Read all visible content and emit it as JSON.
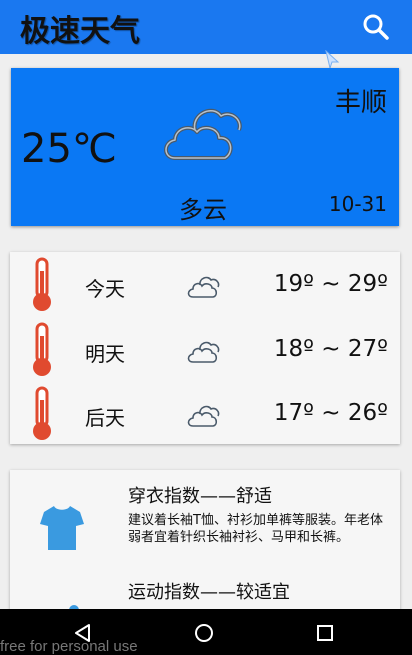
{
  "appbar": {
    "title": "极速天气",
    "search_icon": "search-icon"
  },
  "current": {
    "city": "丰顺",
    "temperature": "25℃",
    "condition": "多云",
    "date": "10-31",
    "icon": "cloud-icon"
  },
  "forecast": [
    {
      "day": "今天",
      "range": "19º ~ 29º",
      "icon": "cloud-icon"
    },
    {
      "day": "明天",
      "range": "18º ~ 27º",
      "icon": "cloud-icon"
    },
    {
      "day": "后天",
      "range": "17º ~ 26º",
      "icon": "cloud-icon"
    }
  ],
  "life": {
    "clothing_title": "穿衣指数——舒适",
    "clothing_text": "建议着长袖T恤、衬衫加单裤等服装。年老体弱者宜着针织长袖衬衫、马甲和长裤。",
    "sport_title": "运动指数——较适宜"
  },
  "navbar": {
    "back": "back-icon",
    "home": "home-icon",
    "recents": "recents-icon"
  },
  "watermark": "free for personal use",
  "colors": {
    "appbar": "#1a78f0",
    "hero": "#0a78f4",
    "thermometer": "#e04a2f",
    "shirt": "#3a9ae0"
  }
}
